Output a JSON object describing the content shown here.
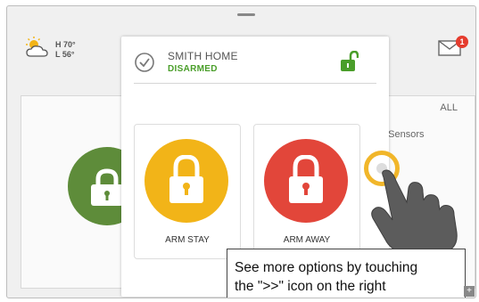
{
  "weather": {
    "high": "H 70°",
    "low": "L 56°",
    "icon": "partly-cloudy-icon"
  },
  "notifications": {
    "count": "1",
    "icon": "mail-icon"
  },
  "background": {
    "filter_label": "ALL",
    "sensors_label": "e Sensors"
  },
  "modal": {
    "home_name": "SMITH HOME",
    "status": "DISARMED",
    "status_color": "#4a9e2a",
    "arm_stay_label": "ARM STAY",
    "arm_away_label": "ARM AWAY",
    "arm_stay_color": "#f2b418",
    "arm_away_color": "#e2463a"
  },
  "tooltip": {
    "line1": "See more options by touching",
    "line2": "the \">>\" icon on the right"
  }
}
